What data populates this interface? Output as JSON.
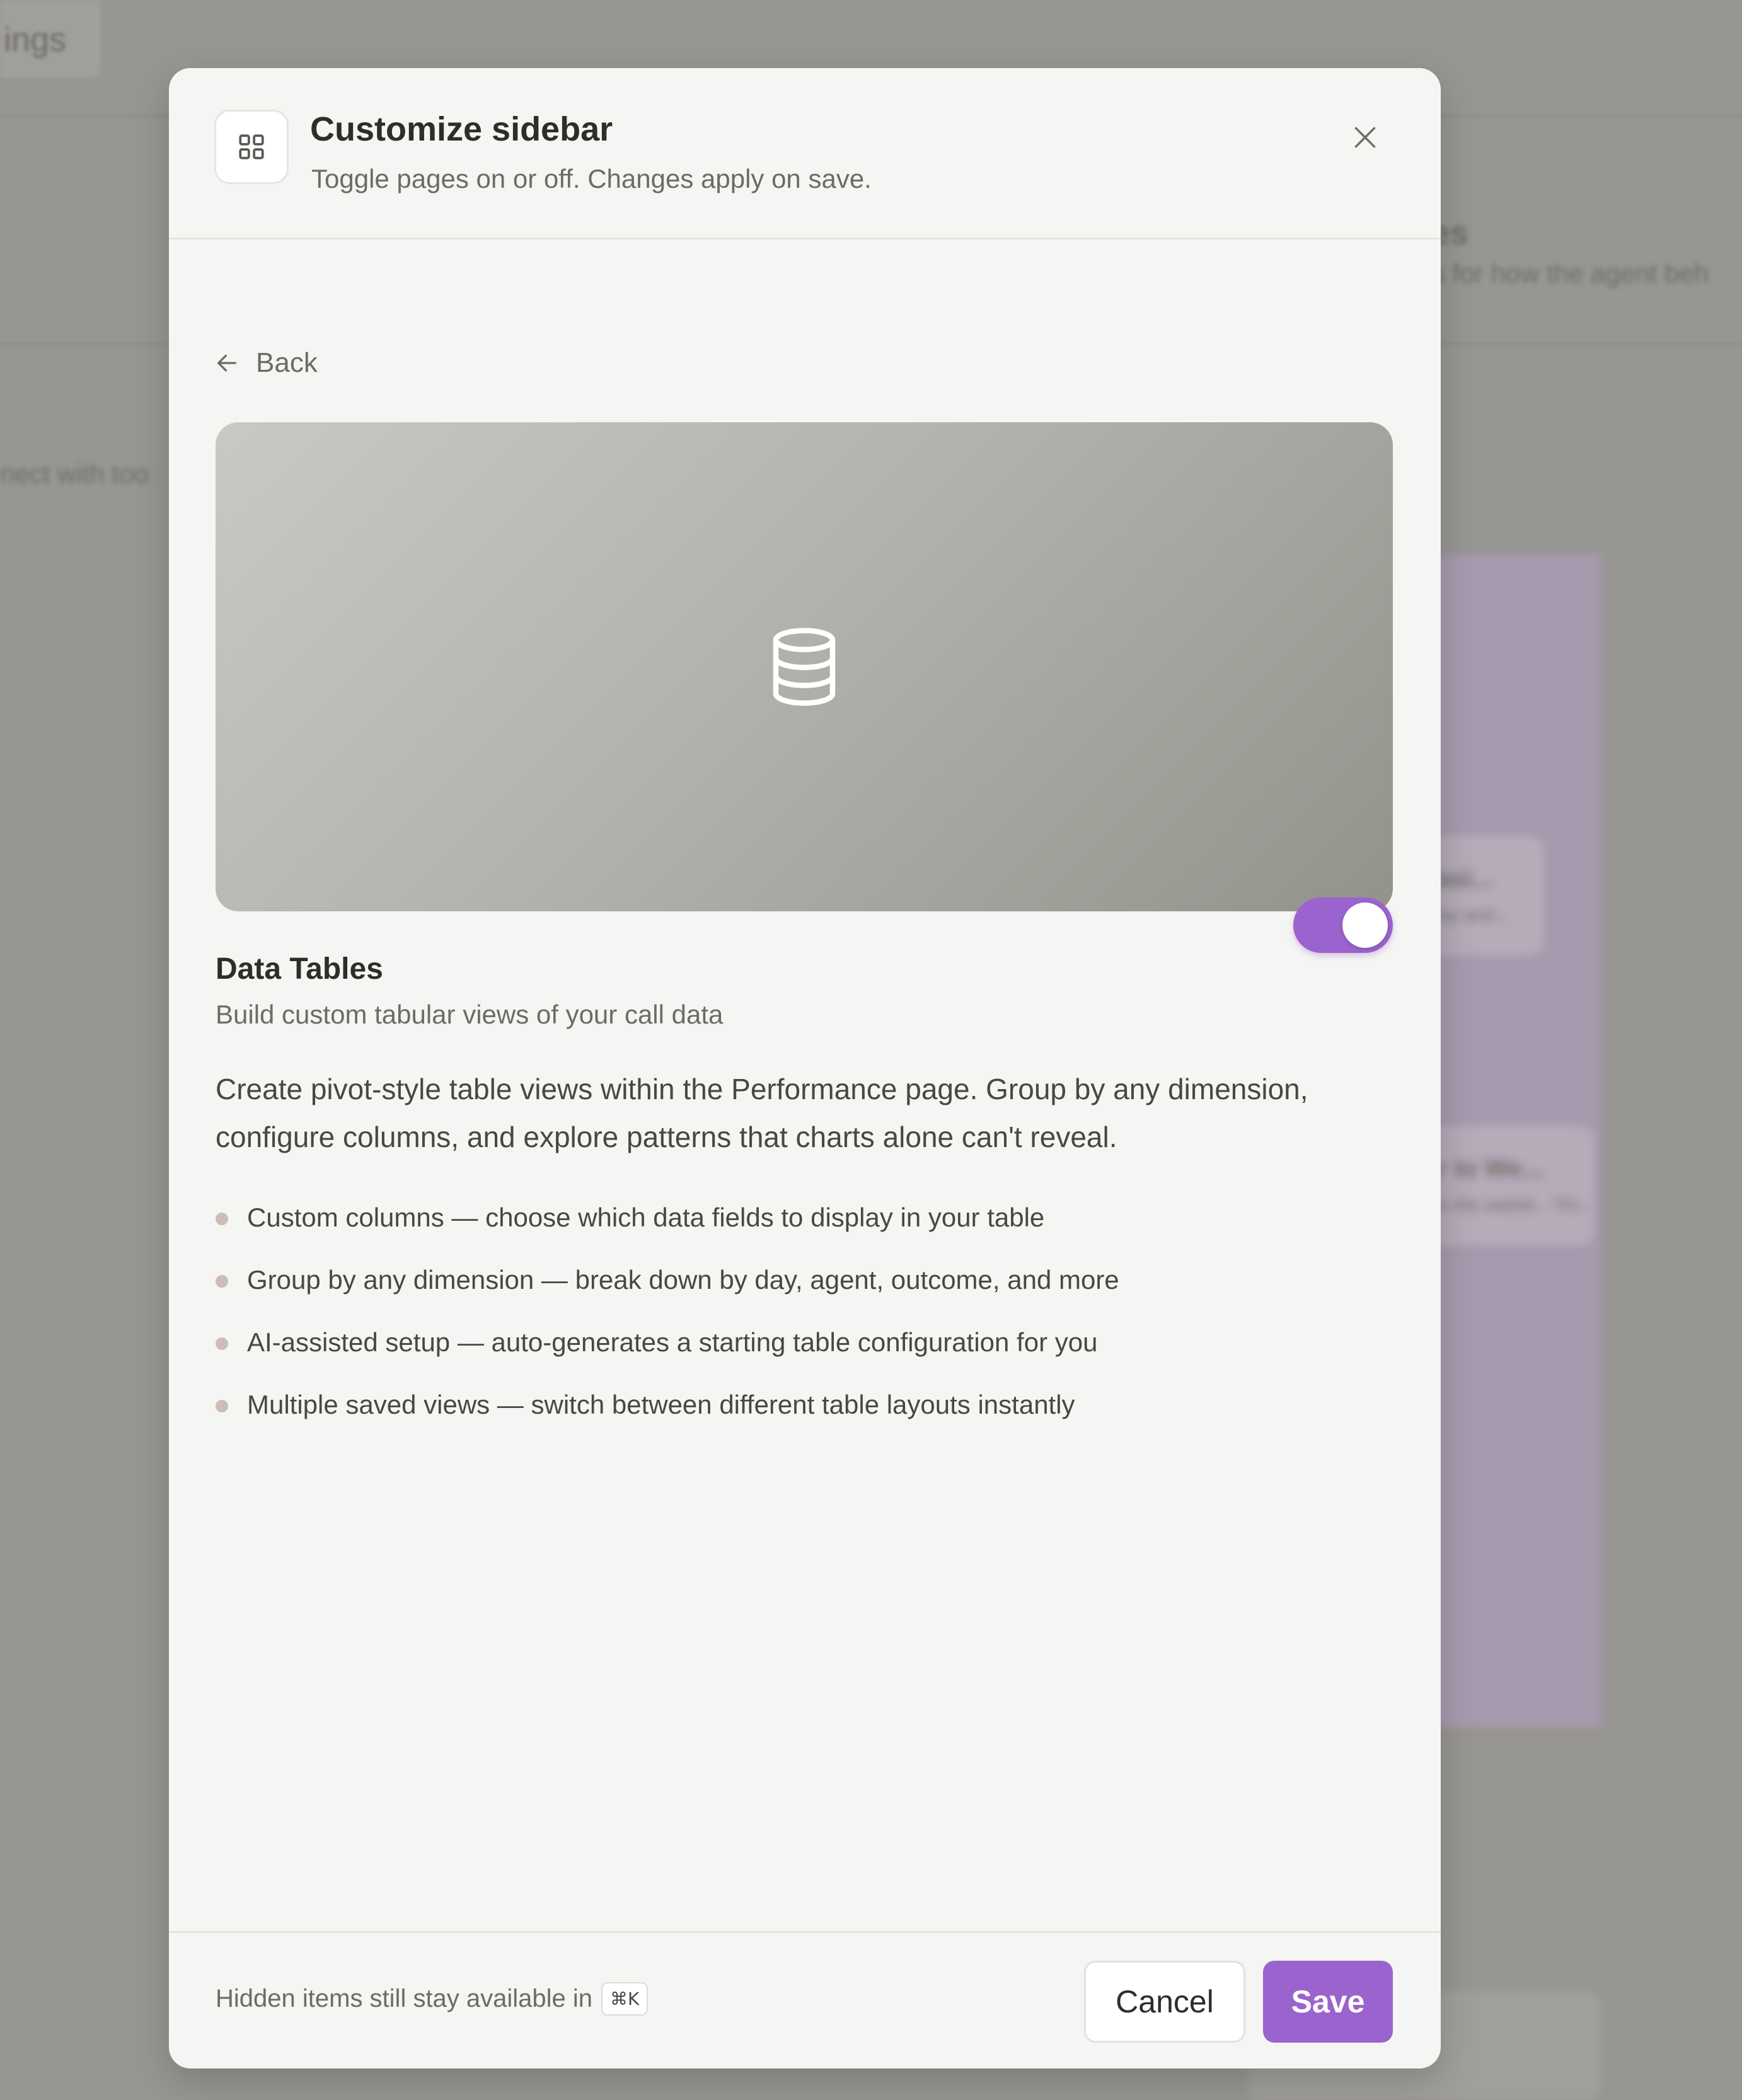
{
  "background": {
    "tab_text": "ings",
    "heading_fragment": "es",
    "sub_fragment": "s for how the agent beh",
    "left_fragment": "nect with too",
    "card1_title": "asi...",
    "card1_text": "lay and...",
    "card2_title": "r to We...",
    "card2_text": "is the websit... Thi..."
  },
  "modal": {
    "icon": "grid-icon",
    "title": "Customize sidebar",
    "subtitle": "Toggle pages on or off. Changes apply on save.",
    "close_icon": "close-icon"
  },
  "nav": {
    "back_label": "Back",
    "back_icon": "arrow-left-icon"
  },
  "hero": {
    "icon": "database-icon"
  },
  "feature": {
    "title": "Data Tables",
    "subtitle": "Build custom tabular views of your call data",
    "enabled": true,
    "description": "Create pivot-style table views within the Performance page. Group by any dimension, configure columns, and explore patterns that charts alone can't reveal.",
    "bullets": [
      "Custom columns — choose which data fields to display in your table",
      "Group by any dimension — break down by day, agent, outcome, and more",
      "AI-assisted setup — auto-generates a starting table configuration for you",
      "Multiple saved views — switch between different table layouts instantly"
    ]
  },
  "footer": {
    "hint": "Hidden items still stay available in",
    "shortcut": "⌘K",
    "cancel_label": "Cancel",
    "save_label": "Save"
  },
  "colors": {
    "accent": "#9b63cd",
    "modal_bg": "#f5f5f3",
    "text_primary": "#2f2d2a",
    "text_secondary": "#6e6b67"
  }
}
